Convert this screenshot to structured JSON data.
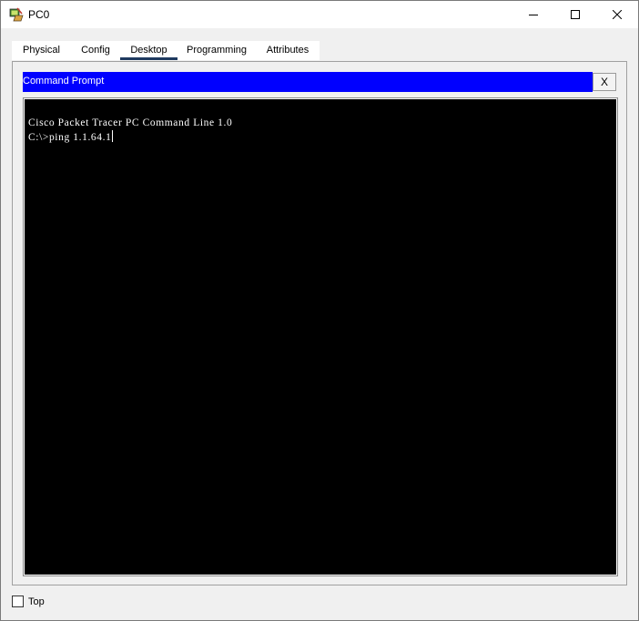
{
  "window": {
    "title": "PC0",
    "icon": "packet-tracer-pc-icon",
    "controls": [
      "minimize-icon",
      "maximize-icon",
      "close-icon"
    ]
  },
  "tabs": [
    {
      "label": "Physical",
      "active": false
    },
    {
      "label": "Config",
      "active": false
    },
    {
      "label": "Desktop",
      "active": true
    },
    {
      "label": "Programming",
      "active": false
    },
    {
      "label": "Attributes",
      "active": false
    }
  ],
  "command_prompt": {
    "title": "Command Prompt",
    "close_label": "X",
    "lines": [
      "Cisco Packet Tracer PC Command Line 1.0",
      "C:\\>ping 1.1.64.1"
    ]
  },
  "footer": {
    "top_label": "Top",
    "top_checked": false
  },
  "colors": {
    "header_bg": "#0000ff",
    "terminal_bg": "#000000",
    "terminal_fg": "#ffffff",
    "active_tab_underline": "#1f3a5f"
  }
}
